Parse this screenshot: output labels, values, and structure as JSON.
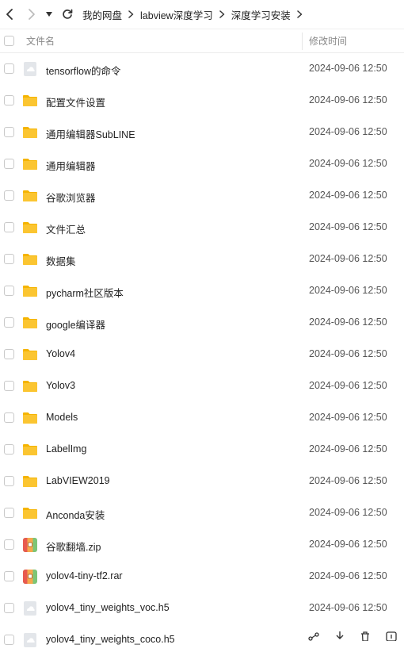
{
  "breadcrumb": [
    "我的网盘",
    "labview深度学习",
    "深度学习安装"
  ],
  "header": {
    "name_label": "文件名",
    "modified_label": "修改时间"
  },
  "files": [
    {
      "name": "tensorflow的命令",
      "type": "file-generic",
      "modified": "2024-09-06 12:50"
    },
    {
      "name": "配置文件设置",
      "type": "folder",
      "modified": "2024-09-06 12:50"
    },
    {
      "name": "通用编辑器SubLINE",
      "type": "folder",
      "modified": "2024-09-06 12:50"
    },
    {
      "name": "通用编辑器",
      "type": "folder",
      "modified": "2024-09-06 12:50"
    },
    {
      "name": "谷歌浏览器",
      "type": "folder",
      "modified": "2024-09-06 12:50"
    },
    {
      "name": "文件汇总",
      "type": "folder",
      "modified": "2024-09-06 12:50"
    },
    {
      "name": "数据集",
      "type": "folder",
      "modified": "2024-09-06 12:50"
    },
    {
      "name": "pycharm社区版本",
      "type": "folder",
      "modified": "2024-09-06 12:50"
    },
    {
      "name": "google编译器",
      "type": "folder",
      "modified": "2024-09-06 12:50"
    },
    {
      "name": "Yolov4",
      "type": "folder",
      "modified": "2024-09-06 12:50"
    },
    {
      "name": "Yolov3",
      "type": "folder",
      "modified": "2024-09-06 12:50"
    },
    {
      "name": "Models",
      "type": "folder",
      "modified": "2024-09-06 12:50"
    },
    {
      "name": "LabelImg",
      "type": "folder",
      "modified": "2024-09-06 12:50"
    },
    {
      "name": "LabVIEW2019",
      "type": "folder",
      "modified": "2024-09-06 12:50"
    },
    {
      "name": "Anconda安装",
      "type": "folder",
      "modified": "2024-09-06 12:50"
    },
    {
      "name": "谷歌翻墙.zip",
      "type": "archive",
      "modified": "2024-09-06 12:50"
    },
    {
      "name": "yolov4-tiny-tf2.rar",
      "type": "archive",
      "modified": "2024-09-06 12:50"
    },
    {
      "name": "yolov4_tiny_weights_voc.h5",
      "type": "file-generic",
      "modified": "2024-09-06 12:50"
    },
    {
      "name": "yolov4_tiny_weights_coco.h5",
      "type": "file-generic",
      "modified": ""
    }
  ],
  "colors": {
    "folder": "#fbc531",
    "folder_tab": "#f5b400",
    "archive_red": "#e85a4f",
    "archive_green": "#7cc576"
  }
}
